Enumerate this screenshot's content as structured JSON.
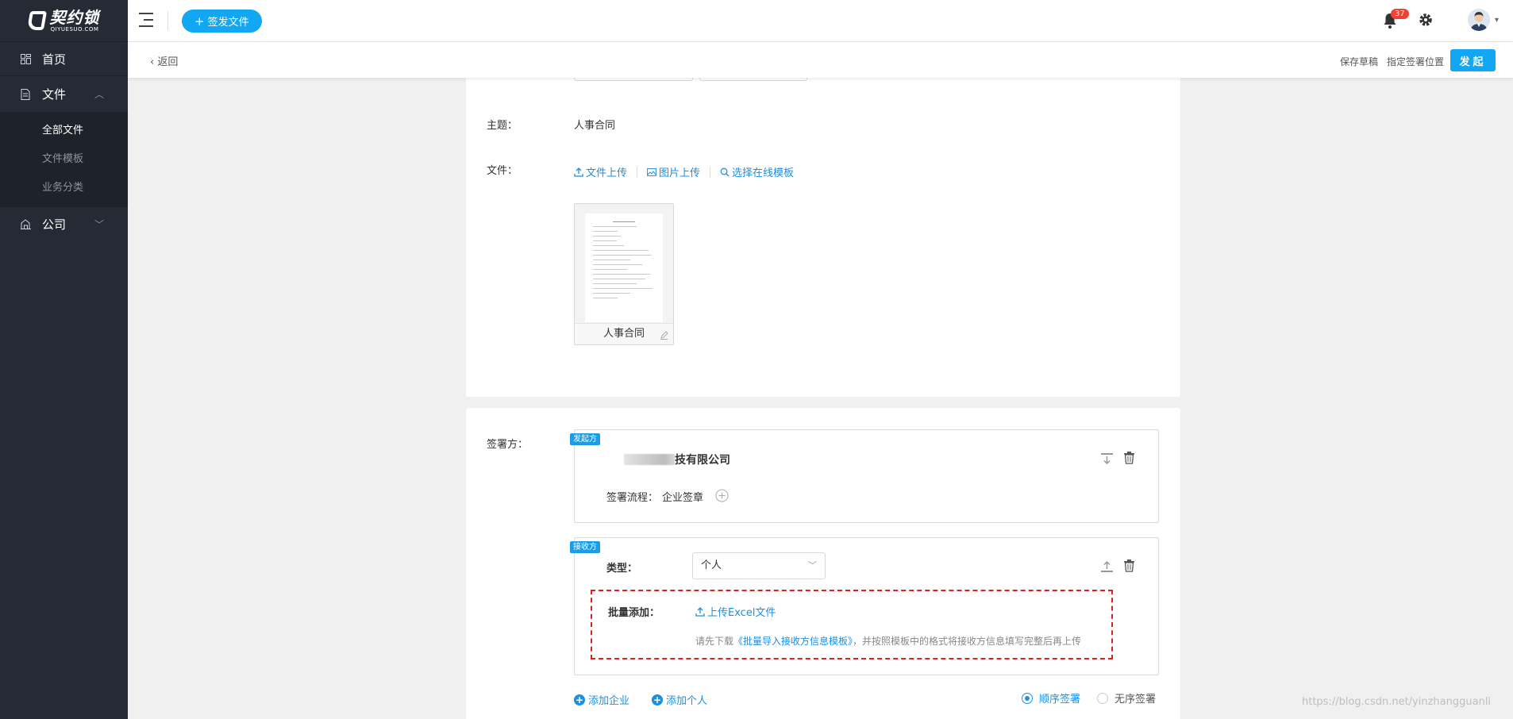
{
  "app": {
    "logo_main": "契约锁",
    "logo_sub": "QIYUESUO.COM"
  },
  "sidebar": {
    "items": [
      {
        "label": "首页",
        "icon": "dashboard-icon"
      },
      {
        "label": "文件",
        "icon": "document-icon",
        "expanded": true,
        "children": [
          "全部文件",
          "文件模板",
          "业务分类"
        ],
        "active_child": "全部文件"
      },
      {
        "label": "公司",
        "icon": "company-icon"
      }
    ]
  },
  "topbar": {
    "send_button": "签发文件",
    "notification_count": "37"
  },
  "subbar": {
    "back_label": "返回",
    "save_draft": "保存草稿",
    "assign_position": "指定签署位置",
    "launch": "发起"
  },
  "form": {
    "subject_label": "主题：",
    "subject_value": "人事合同",
    "file_label": "文件：",
    "file_links": [
      "文件上传",
      "图片上传",
      "选择在线模板"
    ],
    "file_name": "人事合同"
  },
  "signers": {
    "label": "签署方：",
    "initiator": {
      "tag": "发起方",
      "company_visible": "技有限公司",
      "flow_label": "签署流程：",
      "flow_value": "企业签章"
    },
    "receiver": {
      "tag": "接收方",
      "type_label": "类型：",
      "type_value": "个人",
      "batch_label": "批量添加：",
      "upload_link": "上传Excel文件",
      "hint_pre": "请先下载",
      "hint_link": "《批量导入接收方信息模板》",
      "hint_post": "，并按照模板中的格式将接收方信息填写完整后再上传"
    },
    "add_company": "添加企业",
    "add_person": "添加个人",
    "sequential": "顺序签署",
    "unordered": "无序签署",
    "selected_mode": "顺序签署"
  },
  "watermark": "https://blog.csdn.net/yinzhangguanli",
  "colors": {
    "sidebar_bg": "#252b35",
    "accent": "#11a7f2",
    "link": "#1d8fe0",
    "dashed_highlight": "#e0201c",
    "badge": "#f04134"
  }
}
